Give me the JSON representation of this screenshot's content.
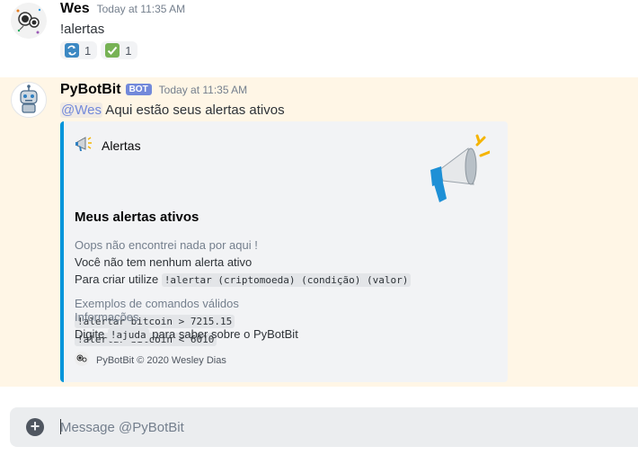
{
  "messages": [
    {
      "username": "Wes",
      "timestamp": "Today at 11:35 AM",
      "content": "!alertas",
      "avatar_icon": "astronaut-avatar-icon",
      "reactions": [
        {
          "emoji": "repeat-icon",
          "color": "#3b88c3",
          "count": "1"
        },
        {
          "emoji": "check-mark-icon",
          "color": "#77b255",
          "count": "1"
        }
      ]
    },
    {
      "username": "PyBotBit",
      "bot_tag": "BOT",
      "timestamp": "Today at 11:35 AM",
      "mention": "@Wes",
      "content": " Aqui estão seus alertas ativos",
      "avatar_icon": "robot-avatar-icon",
      "embed": {
        "accent": "#0095da",
        "author": "Alertas",
        "author_icon": "megaphone-icon",
        "thumbnail_icon": "megaphone-icon",
        "title": "Meus alertas ativos",
        "fields": [
          {
            "name": "Oops não encontrei nada por aqui !",
            "line1": "Você não tem nenhum alerta ativo",
            "line2_prefix": "Para criar utilize ",
            "line2_code": "!alertar (criptomoeda) (condição) (valor)"
          },
          {
            "name": "Exemplos de comandos válidos",
            "code1": "!alertar bitcoin > 7215.15",
            "code2": "!alertar bitcoin < 6010"
          },
          {
            "name": "Informações",
            "prefix": "Digite ",
            "code": "!ajuda",
            "suffix": " para saber sobre o PyBotBit"
          }
        ],
        "footer": "PyBotBit © 2020 Wesley Dias",
        "footer_icon": "astronaut-avatar-icon"
      }
    }
  ],
  "composer": {
    "placeholder": "Message @PyBotBit",
    "plus_icon": "add-attachment-icon"
  }
}
